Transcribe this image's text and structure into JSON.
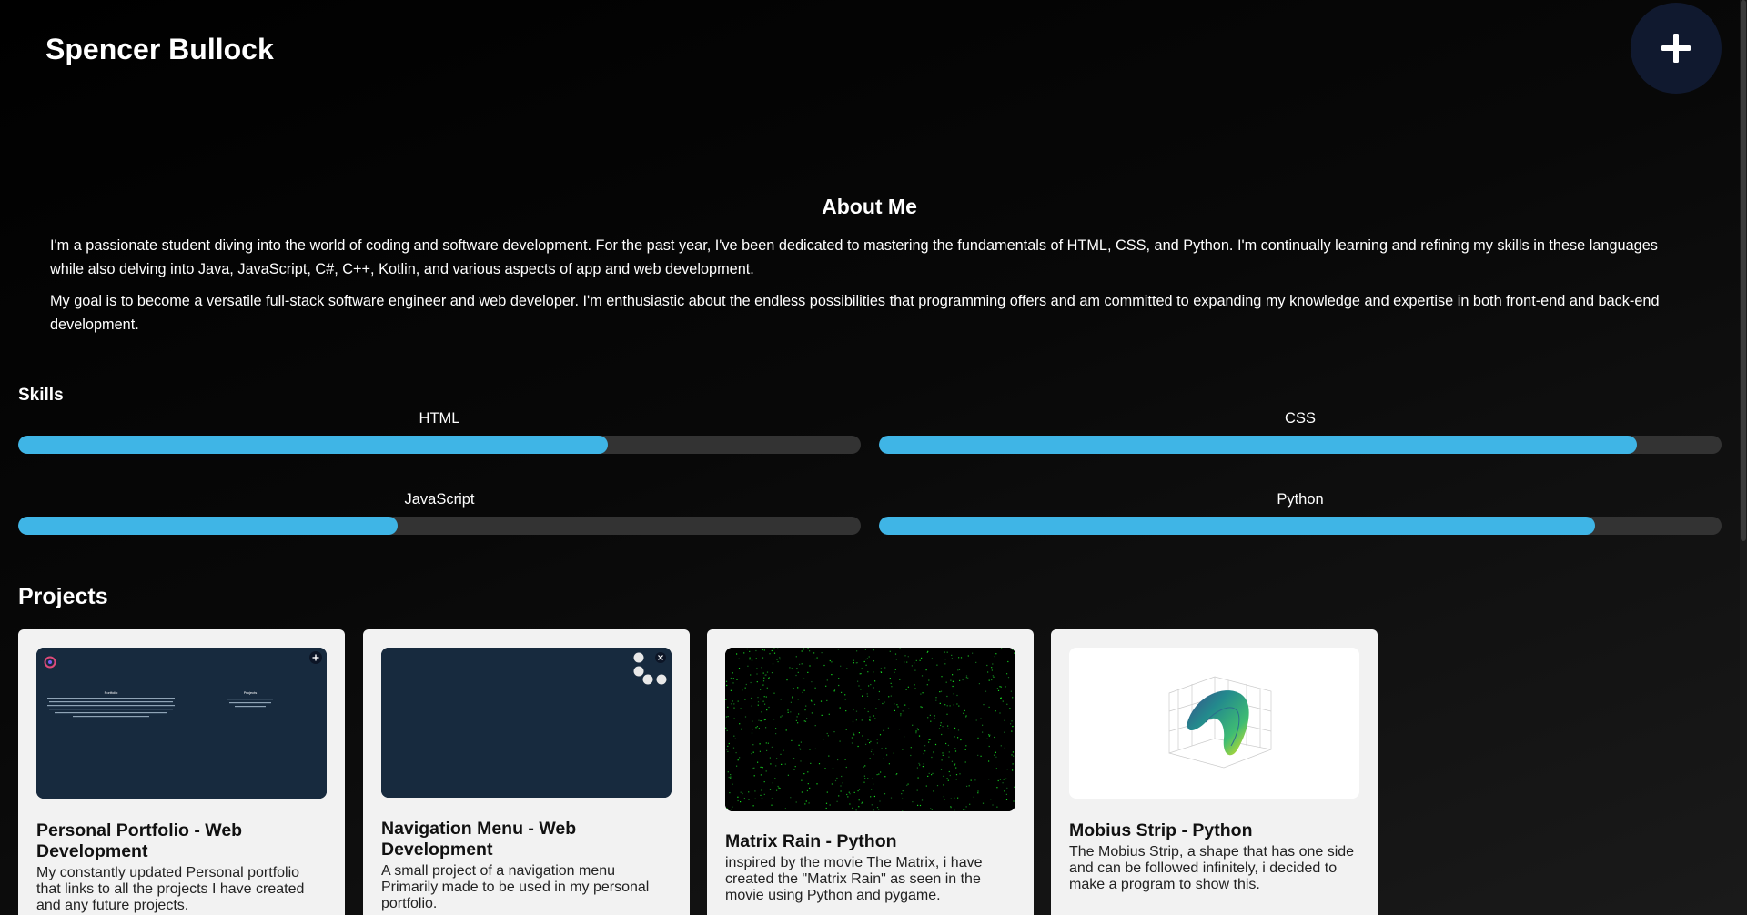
{
  "header": {
    "title": "Spencer Bullock",
    "menu_icon": "plus-icon"
  },
  "about": {
    "title": "About Me",
    "paragraphs": [
      "I'm a passionate student diving into the world of coding and software development. For the past year, I've been dedicated to mastering the fundamentals of HTML, CSS, and Python. I'm continually learning and refining my skills in these languages while also delving into Java, JavaScript, C#, C++, Kotlin, and various aspects of app and web development.",
      "My goal is to become a versatile full-stack software engineer and web developer. I'm enthusiastic about the endless possibilities that programming offers and am committed to expanding my knowledge and expertise in both front-end and back-end development."
    ]
  },
  "skills": {
    "title": "Skills",
    "items": [
      {
        "label": "HTML",
        "level": 0.7
      },
      {
        "label": "CSS",
        "level": 0.9
      },
      {
        "label": "JavaScript",
        "level": 0.45
      },
      {
        "label": "Python",
        "level": 0.85
      }
    ]
  },
  "projects": {
    "title": "Projects",
    "cards": [
      {
        "title": "Personal Portfolio - Web Development",
        "description": "My constantly updated Personal portfolio that links to all the projects I have created and any future projects.",
        "thumb": {
          "logo_icon": "logo-icon",
          "menu_icon": "plus-icon",
          "heading": "Portfolio",
          "side_heading": "Projects"
        }
      },
      {
        "title": "Navigation Menu - Web Development",
        "description": "A small project of a navigation menu Primarily made to be used in my personal portfolio."
      },
      {
        "title": "Matrix Rain - Python",
        "description": "inspired by the movie The Matrix, i have created the \"Matrix Rain\" as seen in the movie using Python and pygame."
      },
      {
        "title": "Mobius Strip - Python",
        "description": "The Mobius Strip, a shape that has one side and can be followed infinitely, i decided to make a program to show this."
      }
    ]
  },
  "colors": {
    "accent": "#3fb5e6",
    "track": "#333333",
    "menu_button": "#10192f",
    "card_bg": "#f2f2f2",
    "thumb_navy": "#172a3e"
  }
}
